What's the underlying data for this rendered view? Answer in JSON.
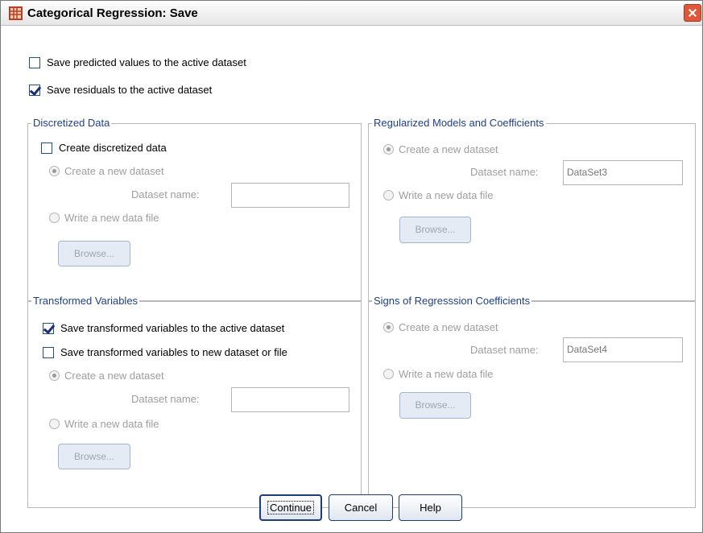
{
  "window": {
    "title": "Categorical Regression: Save"
  },
  "top": {
    "save_predicted": {
      "label": "Save predicted values to the active dataset",
      "checked": false
    },
    "save_residuals": {
      "label": "Save residuals to the active dataset",
      "checked": true
    }
  },
  "discretized": {
    "legend": "Discretized Data",
    "create_label": "Create discretized data",
    "new_dataset_label": "Create a new dataset",
    "dataset_name_label": "Dataset name:",
    "dataset_name_value": "",
    "write_file_label": "Write a new data file",
    "browse_label": "Browse..."
  },
  "regularized": {
    "legend": "Regularized Models and Coefficients",
    "new_dataset_label": "Create a new dataset",
    "dataset_name_label": "Dataset name:",
    "dataset_name_value": "DataSet3",
    "write_file_label": "Write a new data file",
    "browse_label": "Browse..."
  },
  "transformed": {
    "legend": "Transformed Variables",
    "save_active_label": "Save transformed variables to the active dataset",
    "save_new_label": "Save transformed variables to new dataset or file",
    "new_dataset_label": "Create a new dataset",
    "dataset_name_label": "Dataset name:",
    "dataset_name_value": "",
    "write_file_label": "Write a new data file",
    "browse_label": "Browse..."
  },
  "signs": {
    "legend": "Signs of Regresssion Coefficients",
    "new_dataset_label": "Create a new dataset",
    "dataset_name_label": "Dataset name:",
    "dataset_name_value": "DataSet4",
    "write_file_label": "Write a new data file",
    "browse_label": "Browse..."
  },
  "buttons": {
    "continue": "Continue",
    "cancel": "Cancel",
    "help": "Help"
  }
}
